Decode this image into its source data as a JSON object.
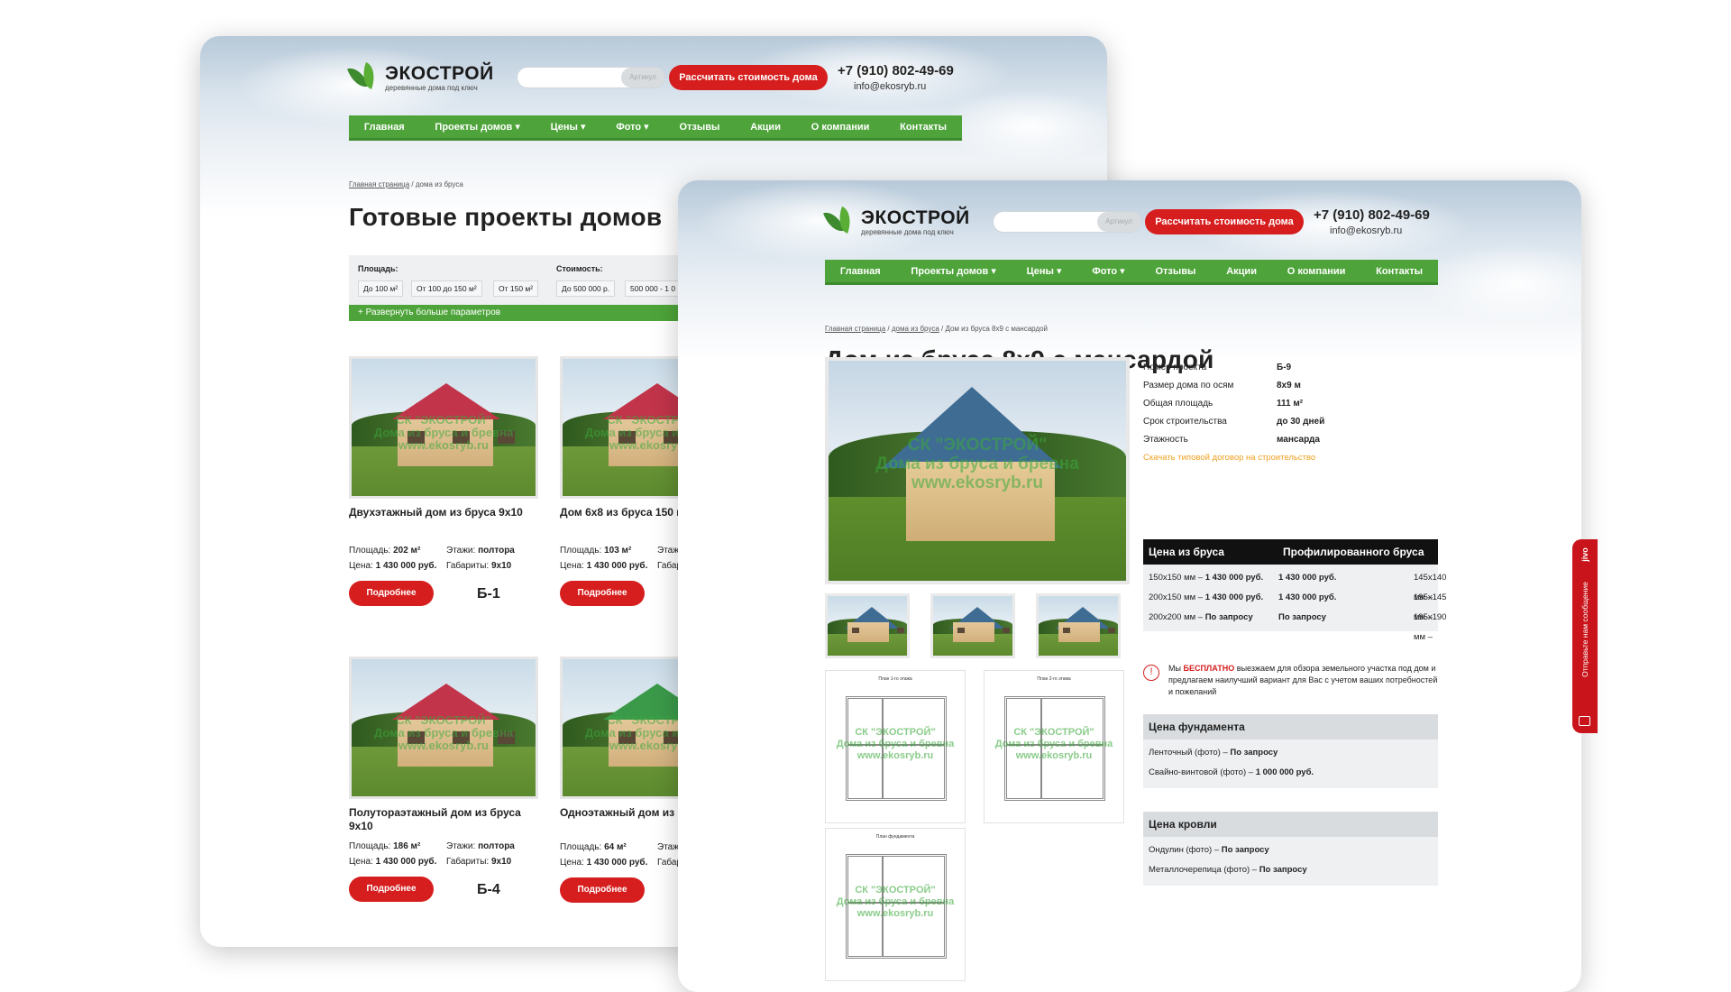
{
  "brand": {
    "name": "ЭКОСТРОЙ",
    "tagline": "деревянные дома под ключ"
  },
  "search": {
    "placeholder": "",
    "hint": "Артикул"
  },
  "header": {
    "calc_button": "Рассчитать стоимость дома",
    "phone": "+7 (910) 802-49-69",
    "email": "info@ekosryb.ru"
  },
  "nav": [
    "Главная",
    "Проекты домов",
    "Цены",
    "Фото",
    "Отзывы",
    "Акции",
    "О компании",
    "Контакты"
  ],
  "nav_dropdown_suffix": " ▾",
  "catalog": {
    "breadcrumb": {
      "home": "Главная страница",
      "sep": " / ",
      "current": "дома из бруса"
    },
    "title": "Готовые проекты домов",
    "filter": {
      "area_label": "Площадь:",
      "area_chips": [
        "До 100 м²",
        "От 100 до 150 м²",
        "От 150 м²"
      ],
      "price_label": "Стоимость:",
      "price_chips": [
        "До 500 000 р.",
        "500 000 - 1 0"
      ],
      "expand": "+ Развернуть больше параметров"
    },
    "cards": [
      {
        "title": "Двухэтажный дом из бруса 9x10",
        "area": "202 м²",
        "floors": "полтора",
        "price": "1 430 000 руб.",
        "size": "9x10",
        "code": "Б-1"
      },
      {
        "title": "Дом 6x8 из бруса 150 м",
        "area": "103 м²",
        "floors": "",
        "price": "1 430 000 руб.",
        "size": "",
        "code": ""
      },
      {
        "title": "Полутораэтажный дом из бруса 9x10",
        "area": "186 м²",
        "floors": "полтора",
        "price": "1 430 000 руб.",
        "size": "9x10",
        "code": "Б-4"
      },
      {
        "title": "Одноэтажный дом из",
        "area": "64 м²",
        "floors": "",
        "price": "1 430 000 руб.",
        "size": "",
        "code": ""
      }
    ],
    "labels": {
      "area": "Площадь:",
      "floors": "Этажи:",
      "price": "Цена:",
      "size": "Габариты:",
      "floors_cut": "Этаж",
      "size_cut": "Габар",
      "more": "Подробнее"
    },
    "watermark": [
      "СК \"ЭКОСТРОЙ\"",
      "Дома из бруса и бревна",
      "www.ekosryb.ru"
    ]
  },
  "product": {
    "breadcrumb": {
      "home": "Главная страница",
      "mid": "дома из бруса",
      "current": "Дом из бруса 8x9 с мансардой"
    },
    "title": "Дом из бруса 8x9 с мансардой",
    "specs": [
      {
        "k": "Номер проекта",
        "v": "Б-9"
      },
      {
        "k": "Размер дома по осям",
        "v": "8x9 м"
      },
      {
        "k": "Общая площадь",
        "v": "111 м²"
      },
      {
        "k": "Срок строительства",
        "v": "до 30 дней"
      },
      {
        "k": "Этажность",
        "v": "мансарда"
      }
    ],
    "download": "Скачать типовой договор на строительство",
    "price_table": {
      "h1": "Цена из бруса",
      "h2": "Профилированного бруса",
      "rows": [
        {
          "a": "150x150 мм – ",
          "av": "1 430 000 руб.",
          "b": "145x140 мм – ",
          "bv": "1 430 000 руб."
        },
        {
          "a": "200x150 мм – ",
          "av": "1 430 000 руб.",
          "b": "195x145 мм – ",
          "bv": "1 430 000 руб."
        },
        {
          "a": "200x200 мм – ",
          "av": "По запросу",
          "b": "195x190 мм – ",
          "bv": "По запросу"
        }
      ]
    },
    "note": {
      "pre": "Мы ",
      "free": "БЕСПЛАТНО",
      "post": " выезжаем для обзора земельного участка под дом и предлагаем наилучший вариант для Вас с учетом ваших потребностей и пожеланий"
    },
    "foundation": {
      "title": "Цена фундамента",
      "rows": [
        {
          "k": "Ленточный (фото) – ",
          "v": "По запросу"
        },
        {
          "k": "Свайно-винтовой (фото) – ",
          "v": "1 000 000 руб."
        }
      ]
    },
    "roof": {
      "title": "Цена кровли",
      "rows": [
        {
          "k": "Ондулин (фото) – ",
          "v": "По запросу"
        },
        {
          "k": "Металлочерепица (фото) – ",
          "v": "По запросу"
        }
      ]
    },
    "plans": [
      "План 1-го этажа",
      "План 2-го этажа",
      "План фундамента"
    ]
  },
  "chat": {
    "label": "Отправьте нам сообщение",
    "brand": "jivo"
  },
  "colors": {
    "accent_green": "#4ea43a",
    "accent_red": "#d61e1e",
    "dark": "#111111"
  }
}
